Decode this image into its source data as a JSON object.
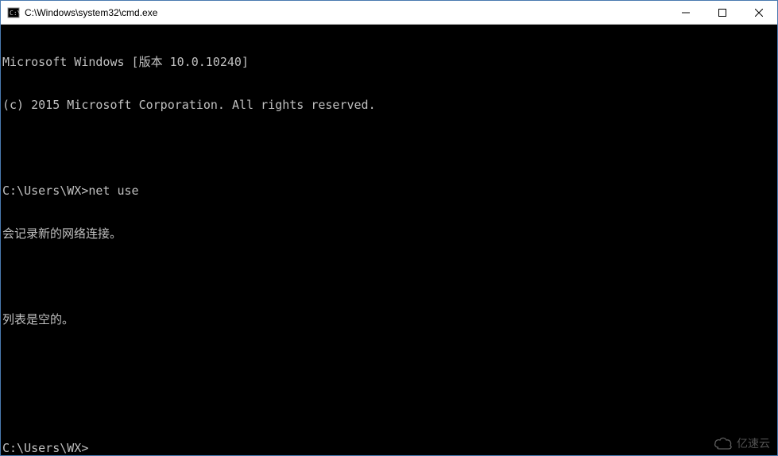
{
  "titlebar": {
    "title": "C:\\Windows\\system32\\cmd.exe"
  },
  "terminal": {
    "lines": [
      "Microsoft Windows [版本 10.0.10240]",
      "(c) 2015 Microsoft Corporation. All rights reserved.",
      "",
      "C:\\Users\\WX>net use",
      "会记录新的网络连接。",
      "",
      "列表是空的。",
      "",
      "",
      "C:\\Users\\WX>"
    ]
  },
  "watermark": {
    "text": "亿速云"
  }
}
